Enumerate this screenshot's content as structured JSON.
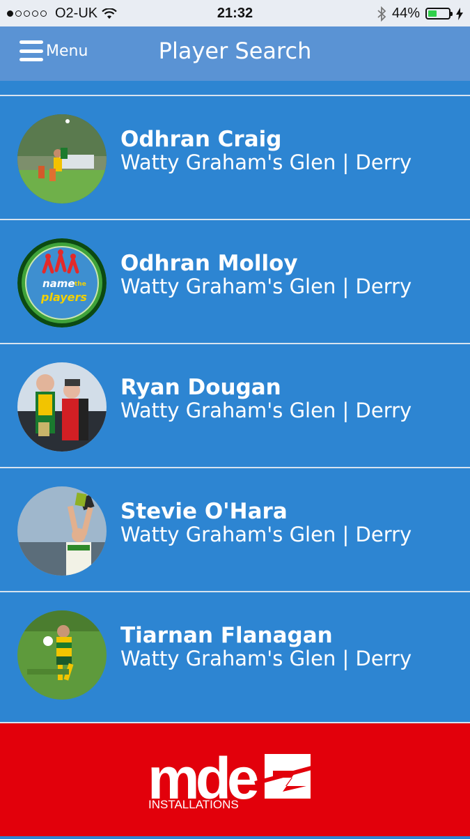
{
  "status_bar": {
    "carrier": "O2-UK",
    "time": "21:32",
    "battery": "44%",
    "battery_level": 0.44,
    "signal_bars": 1
  },
  "nav": {
    "menu_label": "Menu",
    "title": "Player Search"
  },
  "players": [
    {
      "name": "Odhran Craig",
      "club": "Watty Graham's Glen | Derry"
    },
    {
      "name": "Odhran Molloy",
      "club": "Watty Graham's Glen | Derry"
    },
    {
      "name": "Ryan Dougan",
      "club": "Watty Graham's Glen | Derry"
    },
    {
      "name": "Stevie O'Hara",
      "club": "Watty Graham's Glen | Derry"
    },
    {
      "name": "Tiarnan Flanagan",
      "club": "Watty Graham's Glen | Derry"
    }
  ],
  "placeholder_logo": {
    "line1": "name",
    "line2": "the",
    "line3": "players"
  },
  "sponsor": {
    "logo_text": "mde",
    "sub_text": "INSTALLATIONS"
  },
  "colors": {
    "list_bg": "#2d85d2",
    "nav_bg": "#5a93d4",
    "sponsor_bg": "#e2000b"
  }
}
